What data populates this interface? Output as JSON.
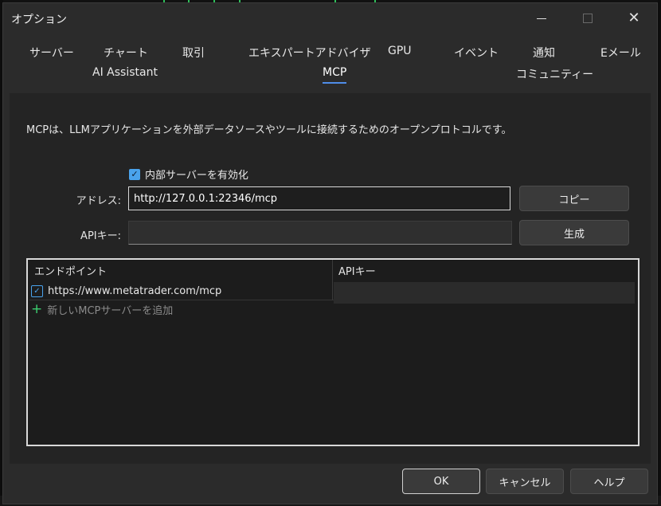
{
  "window": {
    "title": "オプション"
  },
  "tabs": [
    {
      "label": "サーバー"
    },
    {
      "label": "チャート"
    },
    {
      "label": "取引"
    },
    {
      "label": "エキスパートアドバイザ"
    },
    {
      "label": "GPU"
    },
    {
      "label": "イベント"
    },
    {
      "label": "通知"
    },
    {
      "label": "Eメール"
    },
    {
      "label": "AI Assistant"
    },
    {
      "label": "MCP",
      "active": true
    },
    {
      "label": "コミュニティー"
    }
  ],
  "mcp": {
    "description": "MCPは、LLMアプリケーションを外部データソースやツールに接続するためのオープンプロトコルです。",
    "enable_internal_server": {
      "label": "内部サーバーを有効化",
      "checked": true
    },
    "address": {
      "label": "アドレス:",
      "value": "http://127.0.0.1:22346/mcp"
    },
    "api_key": {
      "label": "APIキー:",
      "value": ""
    },
    "copy_button": "コピー",
    "generate_button": "生成",
    "list": {
      "columns": [
        "エンドポイント",
        "APIキー"
      ],
      "rows": [
        {
          "endpoint": "https://www.metatrader.com/mcp",
          "api_key": "",
          "checked": true
        }
      ],
      "add_label": "新しいMCPサーバーを追加"
    }
  },
  "footer": {
    "ok": "OK",
    "cancel": "キャンセル",
    "help": "ヘルプ"
  },
  "colors": {
    "accent": "#4aa3ec",
    "tab_underline": "#4f8de8",
    "add_icon": "#3ccf70"
  }
}
